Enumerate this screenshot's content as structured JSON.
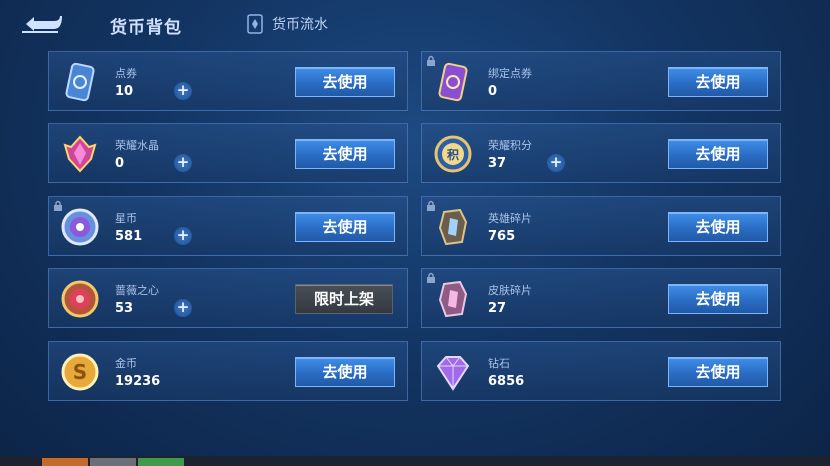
{
  "header": {
    "title": "货币背包",
    "flow_label": "货币流水"
  },
  "colors": {
    "accent": "#2f7bd9",
    "background": "#133563",
    "disabled_button": "#3f444c"
  },
  "cards": [
    {
      "name": "点券",
      "amount": "10",
      "button": "去使用",
      "icon": "coupon-card-icon",
      "has_plus": true,
      "has_lock": false
    },
    {
      "name": "绑定点券",
      "amount": "0",
      "button": "去使用",
      "icon": "bound-coupon-card-icon",
      "has_plus": false,
      "has_lock": true
    },
    {
      "name": "荣耀水晶",
      "amount": "0",
      "button": "去使用",
      "icon": "glory-crystal-icon",
      "has_plus": true,
      "has_lock": false
    },
    {
      "name": "荣耀积分",
      "amount": "37",
      "button": "去使用",
      "icon": "glory-points-icon",
      "has_plus": true,
      "has_lock": false
    },
    {
      "name": "星币",
      "amount": "581",
      "button": "去使用",
      "icon": "star-coin-icon",
      "has_plus": true,
      "has_lock": true
    },
    {
      "name": "英雄碎片",
      "amount": "765",
      "button": "去使用",
      "icon": "hero-shard-icon",
      "has_plus": false,
      "has_lock": true
    },
    {
      "name": "蔷薇之心",
      "amount": "53",
      "button": "限时上架",
      "icon": "rose-heart-icon",
      "has_plus": true,
      "has_lock": false
    },
    {
      "name": "皮肤碎片",
      "amount": "27",
      "button": "去使用",
      "icon": "skin-shard-icon",
      "has_plus": false,
      "has_lock": true
    },
    {
      "name": "金币",
      "amount": "19236",
      "button": "去使用",
      "icon": "gold-coin-icon",
      "has_plus": false,
      "has_lock": false
    },
    {
      "name": "钻石",
      "amount": "6856",
      "button": "去使用",
      "icon": "diamond-icon",
      "has_plus": false,
      "has_lock": false
    }
  ]
}
